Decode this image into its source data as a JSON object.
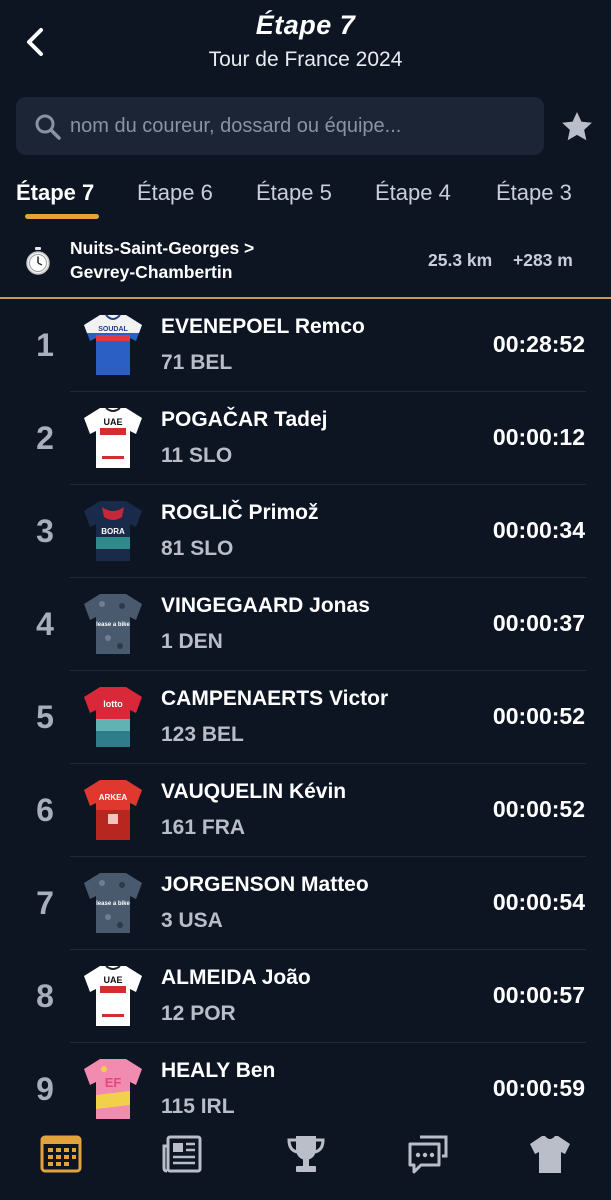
{
  "header": {
    "title": "Étape 7",
    "subtitle": "Tour de France 2024",
    "back_icon": "chevron-left-icon"
  },
  "search": {
    "placeholder": "nom du coureur, dossard ou équipe...",
    "value": ""
  },
  "favorite_icon": "star-icon",
  "tabs": [
    {
      "label": "Étape 7",
      "active": true
    },
    {
      "label": "Étape 6",
      "active": false
    },
    {
      "label": "Étape 5",
      "active": false
    },
    {
      "label": "Étape 4",
      "active": false
    },
    {
      "label": "Étape 3",
      "active": false
    }
  ],
  "stage": {
    "type_icon": "stopwatch-icon",
    "route_line1": "Nuits-Saint-Georges >",
    "route_line2": "Gevrey-Chambertin",
    "distance": "25.3 km",
    "elevation": "+283 m"
  },
  "results": [
    {
      "pos": "1",
      "name": "EVENEPOEL Remco",
      "meta": "71 BEL",
      "time": "00:28:52",
      "team": "soudal"
    },
    {
      "pos": "2",
      "name": "POGAČAR Tadej",
      "meta": "11 SLO",
      "time": "00:00:12",
      "team": "uae"
    },
    {
      "pos": "3",
      "name": "ROGLIČ Primož",
      "meta": "81 SLO",
      "time": "00:00:34",
      "team": "bora"
    },
    {
      "pos": "4",
      "name": "VINGEGAARD Jonas",
      "meta": "1 DEN",
      "time": "00:00:37",
      "team": "visma"
    },
    {
      "pos": "5",
      "name": "CAMPENAERTS Victor",
      "meta": "123 BEL",
      "time": "00:00:52",
      "team": "lotto"
    },
    {
      "pos": "6",
      "name": "VAUQUELIN Kévin",
      "meta": "161 FRA",
      "time": "00:00:52",
      "team": "arkea"
    },
    {
      "pos": "7",
      "name": "JORGENSON Matteo",
      "meta": "3 USA",
      "time": "00:00:54",
      "team": "visma"
    },
    {
      "pos": "8",
      "name": "ALMEIDA João",
      "meta": "12 POR",
      "time": "00:00:57",
      "team": "uae"
    },
    {
      "pos": "9",
      "name": "HEALY Ben",
      "meta": "115 IRL",
      "time": "00:00:59",
      "team": "ef"
    }
  ],
  "jersey_text": {
    "soudal": "SOUDAL",
    "uae": "UAE",
    "bora": "BORA",
    "visma": "lease a bike",
    "lotto": "lotto",
    "arkea": "ARKEA",
    "ef": "EF"
  },
  "bottom_nav": [
    {
      "icon": "calendar-grid-icon",
      "active": true
    },
    {
      "icon": "newspaper-icon",
      "active": false
    },
    {
      "icon": "trophy-icon",
      "active": false
    },
    {
      "icon": "chat-icon",
      "active": false
    },
    {
      "icon": "jersey-icon",
      "active": false
    }
  ],
  "colors": {
    "background": "#0d1523",
    "accent": "#e2a33c",
    "search_bg": "#1c2535"
  }
}
